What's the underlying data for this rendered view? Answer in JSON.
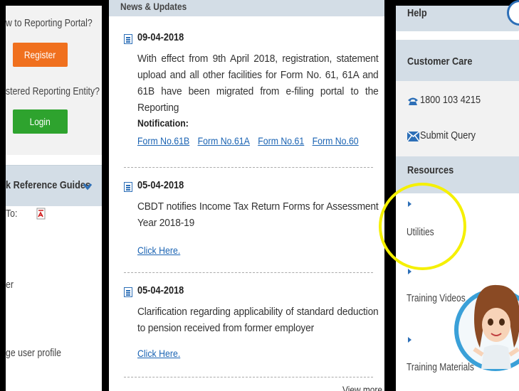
{
  "left": {
    "question1": "w to Reporting Portal?",
    "register_label": "Register",
    "question2": "stered Reporting Entity?",
    "login_label": "Login",
    "quick_ref_title": "k Reference Guides",
    "item_to": "To:",
    "item_er": "er",
    "item_profile": "ge user profile"
  },
  "news": {
    "header": "News & Updates",
    "items": [
      {
        "date": "09-04-2018",
        "text": "With effect from 9th April 2018, registration, statement upload and all other facilities for Form No. 61, 61A and 61B have been migrated from e-filing portal to the Reporting",
        "notification_label": "Notification:",
        "links": [
          "Form No.61B",
          "Form No.61A",
          "Form No.61",
          "Form No.60"
        ]
      },
      {
        "date": "05-04-2018",
        "text": "CBDT notifies Income Tax Return Forms for Assessment Year 2018-19",
        "link": "Click Here."
      },
      {
        "date": "05-04-2018",
        "text": "Clarification regarding applicability of standard deduction to pension received from former employer",
        "link": "Click Here."
      }
    ],
    "view_more": "View more"
  },
  "right": {
    "help": "Help",
    "customer_care": "Customer Care",
    "phone": "1800 103 4215",
    "submit_query": "Submit Query",
    "resources": "Resources",
    "resource_items": [
      "Utilities",
      "Training Videos",
      "Training Materials"
    ]
  },
  "colors": {
    "accent_blue": "#2d6fb7",
    "register_orange": "#f0701e",
    "login_green": "#2ea32e",
    "highlight_yellow": "#f5f000",
    "panel_header": "#d3dde6"
  }
}
